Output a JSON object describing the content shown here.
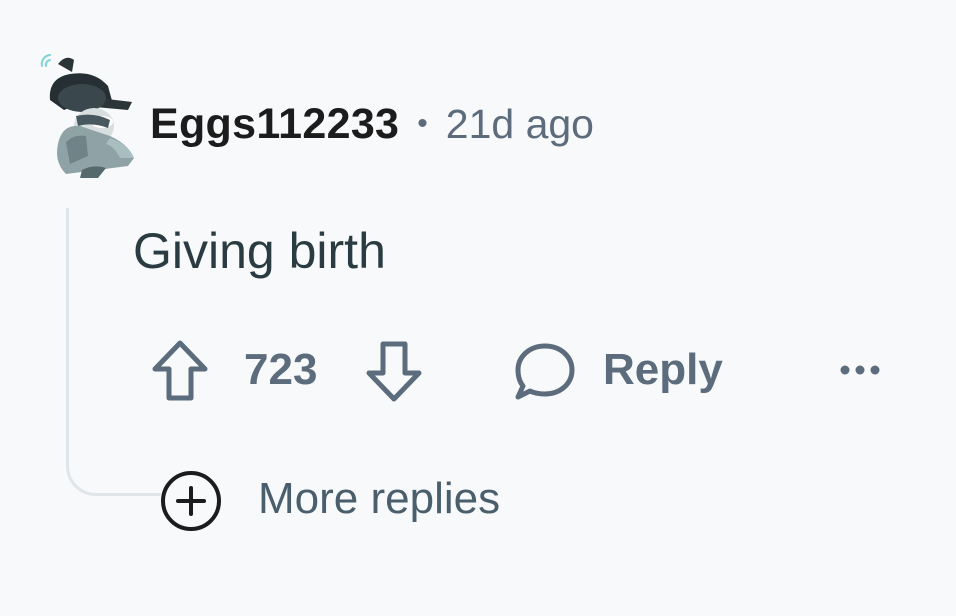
{
  "comment": {
    "username": "Eggs112233",
    "separator": "•",
    "timestamp": "21d ago",
    "body": "Giving birth"
  },
  "actions": {
    "upvote_icon": "arrow-up-outline-icon",
    "vote_count": "723",
    "downvote_icon": "arrow-down-outline-icon",
    "reply_icon": "speech-bubble-icon",
    "reply_label": "Reply",
    "more_icon": "ellipsis-icon"
  },
  "thread": {
    "more_replies_icon": "plus-circle-icon",
    "more_replies_label": "More replies"
  },
  "colors": {
    "background": "#f7f9fa",
    "username": "#1c1c1c",
    "meta": "#5c6c7c",
    "body_text": "#2a3c42",
    "thread_line": "#dfe5e9"
  }
}
